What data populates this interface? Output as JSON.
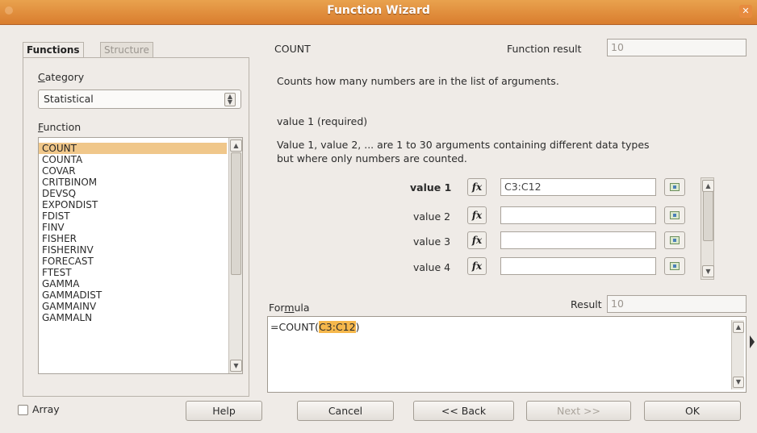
{
  "window": {
    "title": "Function Wizard",
    "close_glyph": "✕"
  },
  "tabs": {
    "functions": "Functions",
    "structure": "Structure"
  },
  "category": {
    "label_prefix": "C",
    "label_rest": "ategory",
    "value": "Statistical"
  },
  "function_list": {
    "label_prefix": "F",
    "label_rest": "unction",
    "items": [
      "COUNT",
      "COUNTA",
      "COVAR",
      "CRITBINOM",
      "DEVSQ",
      "EXPONDIST",
      "FDIST",
      "FINV",
      "FISHER",
      "FISHERINV",
      "FORECAST",
      "FTEST",
      "GAMMA",
      "GAMMADIST",
      "GAMMAINV",
      "GAMMALN"
    ],
    "selected_index": 0
  },
  "function_info": {
    "name": "COUNT",
    "result_label": "Function result",
    "result_value": "10",
    "description": "Counts how many numbers are in the list of arguments.",
    "arg_heading": "value 1 (required)",
    "arg_description_line1": "Value 1, value 2, ... are 1 to 30 arguments containing different data types",
    "arg_description_line2": "but where only numbers are counted."
  },
  "arguments": [
    {
      "label": "value 1",
      "value": "C3:C12",
      "bold": true
    },
    {
      "label": "value 2",
      "value": "",
      "bold": false
    },
    {
      "label": "value 3",
      "value": "",
      "bold": false
    },
    {
      "label": "value 4",
      "value": "",
      "bold": false
    }
  ],
  "formula": {
    "label_pre": "For",
    "label_mid": "m",
    "label_post": "ula",
    "result_label": "Result",
    "result_value": "10",
    "text_prefix": "=COUNT(",
    "text_highlight": "C3:C12",
    "text_suffix": ")"
  },
  "buttons": {
    "array": "Array",
    "help": "Help",
    "cancel": "Cancel",
    "back": "<< Back",
    "next": "Next >>",
    "ok": "OK"
  },
  "icons": {
    "fx": "fx",
    "shrink": "shrink-icon"
  }
}
